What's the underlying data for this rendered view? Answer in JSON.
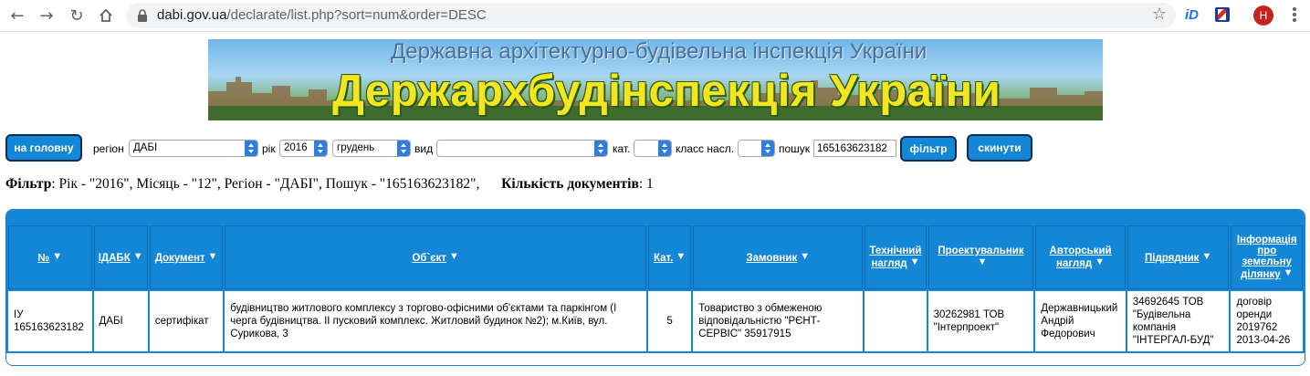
{
  "browser": {
    "url_host": "dabi.gov.ua",
    "url_path": "/declarate/list.php?sort=num&order=DESC",
    "avatar_letter": "H",
    "ext_id_label": "iD",
    "icons": [
      "back-icon",
      "forward-icon",
      "reload-icon",
      "home-icon",
      "lock-icon",
      "star-icon",
      "menu-icon"
    ]
  },
  "banner": {
    "subtitle": "Державна архітектурно-будівельна інспекція України",
    "title": "Держархбудінспекція України"
  },
  "filters": {
    "home_button": "на головну",
    "region_label": "регіон",
    "region_value": "ДАБІ",
    "year_label": "рік",
    "year_value": "2016",
    "month_value": "грудень",
    "type_label": "вид",
    "type_value": "",
    "cat_label": "кат.",
    "cat_value": "",
    "class_label": "класс насл.",
    "class_value": "",
    "search_label": "пошук",
    "search_value": "165163623182",
    "filter_button": "фільтр",
    "reset_button": "скинути"
  },
  "summary": {
    "filter_label": "Фільтр",
    "filter_text": ": Рік - \"2016\", Місяць - \"12\", Регіон - \"ДАБІ\", Пошук - \"165163623182\",",
    "count_label": "Кількість документів",
    "count_text": ": 1"
  },
  "table": {
    "headers": [
      "№",
      "ІДАБК",
      "Документ",
      "Об`єкт",
      "Кат.",
      "Замовник",
      "Технічний нагляд",
      "Проектувальник",
      "Авторський нагляд",
      "Підрядник",
      "Інформація про земельну ділянку"
    ],
    "rows": [
      {
        "num": "ІУ 165163623182",
        "idabk": "ДАБІ",
        "document": "сертифікат",
        "object": "будівництво житлового комплексу з торгово-офісними об'єктами та паркінгом (І черга будівництва. ІІ пусковий комплекс. Житловий будинок №2); м.Київ, вул. Сурикова, 3",
        "cat": "5",
        "customer": "Товариство з обмеженою відповідальністю \"РЄНТ-СЕРВІС\" 35917915",
        "tech_supervision": "",
        "designer": "30262981 ТОВ \"Інтерпроект\"",
        "author_supervision": "Державницький Андрій Федорович",
        "contractor": "34692645 ТОВ \"Будівельна компанія \"ІНТЕРГАЛ-БУД\"",
        "land_info": "договір оренди 2019762 2013-04-26"
      }
    ]
  },
  "colors": {
    "accent": "#1386d6",
    "button_border": "#0b2d55",
    "banner_title": "#f3e620"
  }
}
